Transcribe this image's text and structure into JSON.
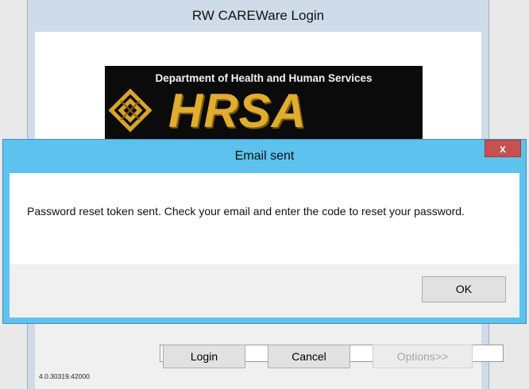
{
  "login_window": {
    "title": "RW CAREWare Login",
    "logo": {
      "department": "Department of Health and Human Services",
      "agency": "HRSA"
    },
    "buttons": {
      "login": "Login",
      "cancel": "Cancel",
      "options": "Options>>"
    },
    "version": "4.0.30319.42000"
  },
  "dialog": {
    "title": "Email sent",
    "close_label": "x",
    "message": "Password reset token sent. Check your email and enter the code to reset your password.",
    "ok_label": "OK"
  },
  "colors": {
    "dialog_frame": "#5dc2ee",
    "close_button": "#c75050",
    "logo_gold": "#e0ad2e"
  },
  "icons": {
    "close": "close-x-icon",
    "logo_mark": "hrsa-knot-icon"
  }
}
